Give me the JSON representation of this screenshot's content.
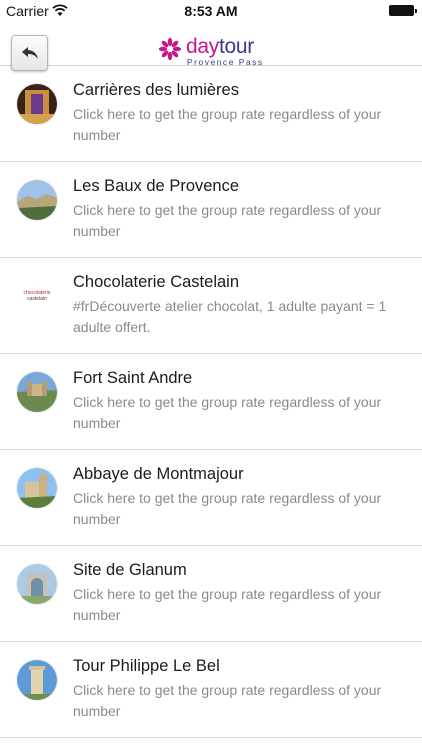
{
  "status_bar": {
    "carrier": "Carrier",
    "time": "8:53 AM"
  },
  "header": {
    "logo": {
      "day": "day",
      "tour": "tour",
      "subtitle": "Provence Pass"
    },
    "back_icon": "reply-arrow-icon"
  },
  "colors": {
    "logo_magenta": "#c7178c",
    "logo_navy": "#3a3a8c",
    "subtitle_gray": "#8a8a8a"
  },
  "list": {
    "items": [
      {
        "title": "Carrières des lumières",
        "description": "Click here to get the group rate regardless of your number"
      },
      {
        "title": "Les Baux de Provence",
        "description": "Click here to get the group rate regardless of your number"
      },
      {
        "title": "Chocolaterie Castelain",
        "description": "#frDécouverte atelier chocolat, 1 adulte payant = 1 adulte offert.",
        "thumb_text": [
          "chocolaterie",
          "castelain"
        ]
      },
      {
        "title": "Fort Saint Andre",
        "description": "Click here to get the group rate regardless of your number"
      },
      {
        "title": "Abbaye de Montmajour",
        "description": "Click here to get the group rate regardless of your number"
      },
      {
        "title": "Site de Glanum",
        "description": "Click here to get the group rate regardless of your number"
      },
      {
        "title": "Tour Philippe Le Bel",
        "description": "Click here to get the group rate regardless of your number"
      }
    ]
  }
}
